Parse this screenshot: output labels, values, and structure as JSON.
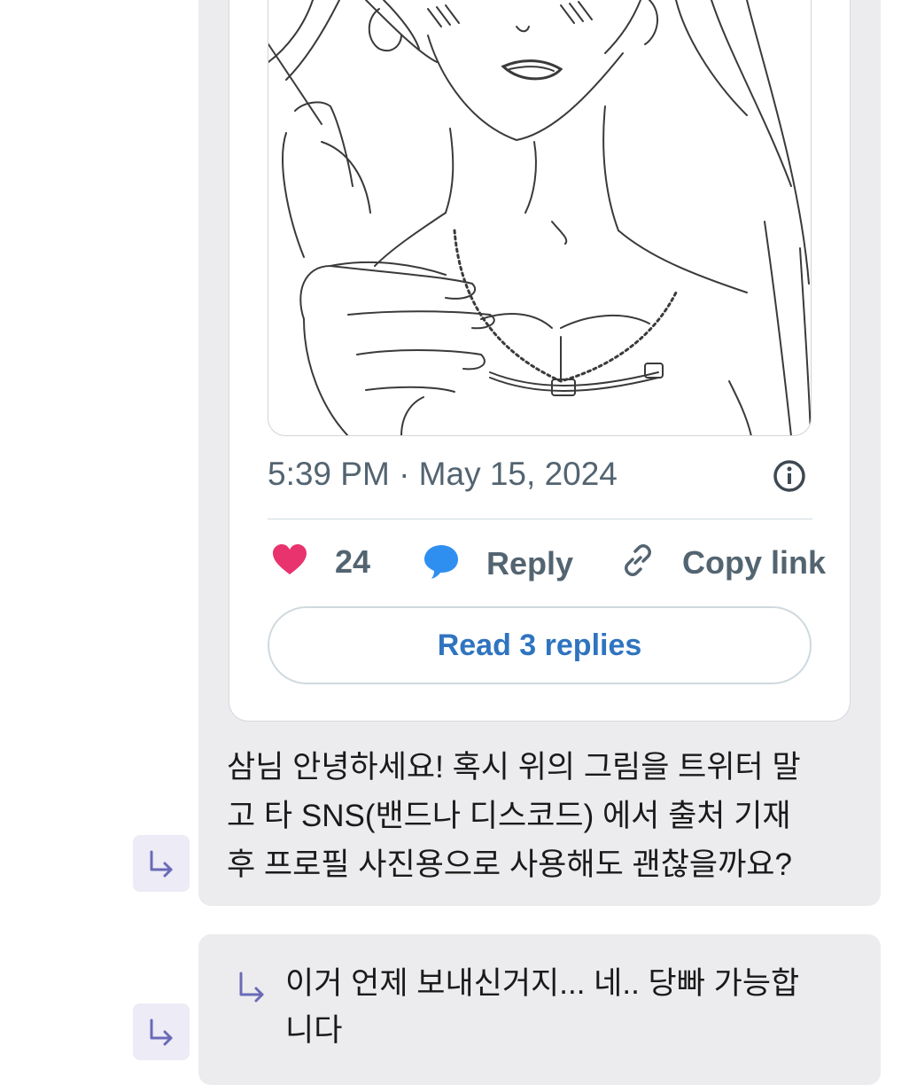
{
  "tweet": {
    "timestamp": "5:39 PM · May 15, 2024",
    "likes": "24",
    "reply_label": "Reply",
    "copy_link_label": "Copy link",
    "read_replies_label": "Read 3 replies",
    "colors": {
      "heart": "#e8336f",
      "reply_bubble": "#2f8ff0",
      "link": "#2f74c0",
      "meta": "#536471"
    }
  },
  "messages": [
    {
      "lines": [
        " 삼님 안녕하세요! 혹시 위의 그림을 트위터 말",
        "고 타 SNS(밴드나 디스코드) 에서 출처 기재",
        "후 프로필 사진용으로 사용해도 괜찮을까요?"
      ]
    },
    {
      "lines": [
        "이거 언제 보내신거지... 네.. 당빠 가능합",
        "니다"
      ]
    }
  ],
  "icons": {
    "reply_arrow": "reply-arrow-icon",
    "info": "info-icon",
    "heart": "heart-icon",
    "comment": "comment-icon",
    "link": "link-icon"
  }
}
